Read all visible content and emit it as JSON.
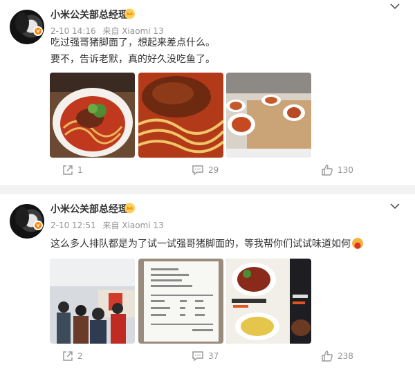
{
  "posts": [
    {
      "author": "小米公关部总经理",
      "time": "2-10 14:16",
      "source": "来自 Xiaomi 13",
      "lines": [
        "吃过强哥猪脚面了，想起来差点什么。",
        "要不，告诉老默，真的好久没吃鱼了。"
      ],
      "repost_count": "1",
      "comment_count": "29",
      "like_count": "130",
      "images": [
        "noodle-bowl-photo",
        "pork-knuckle-closeup-photo",
        "canteen-table-photo"
      ]
    },
    {
      "author": "小米公关部总经理",
      "time": "2-10 12:51",
      "source": "来自 Xiaomi 13",
      "lines": [
        "这么多人排队都是为了试一试强哥猪脚面的，等我帮你们试试味道如何"
      ],
      "repost_count": "2",
      "comment_count": "37",
      "like_count": "238",
      "images": [
        "queue-at-canteen-photo",
        "receipt-photo",
        "menu-board-photo"
      ]
    }
  ],
  "colors": {
    "badge": "#ff8200",
    "meta": "#939393",
    "text": "#333333"
  }
}
